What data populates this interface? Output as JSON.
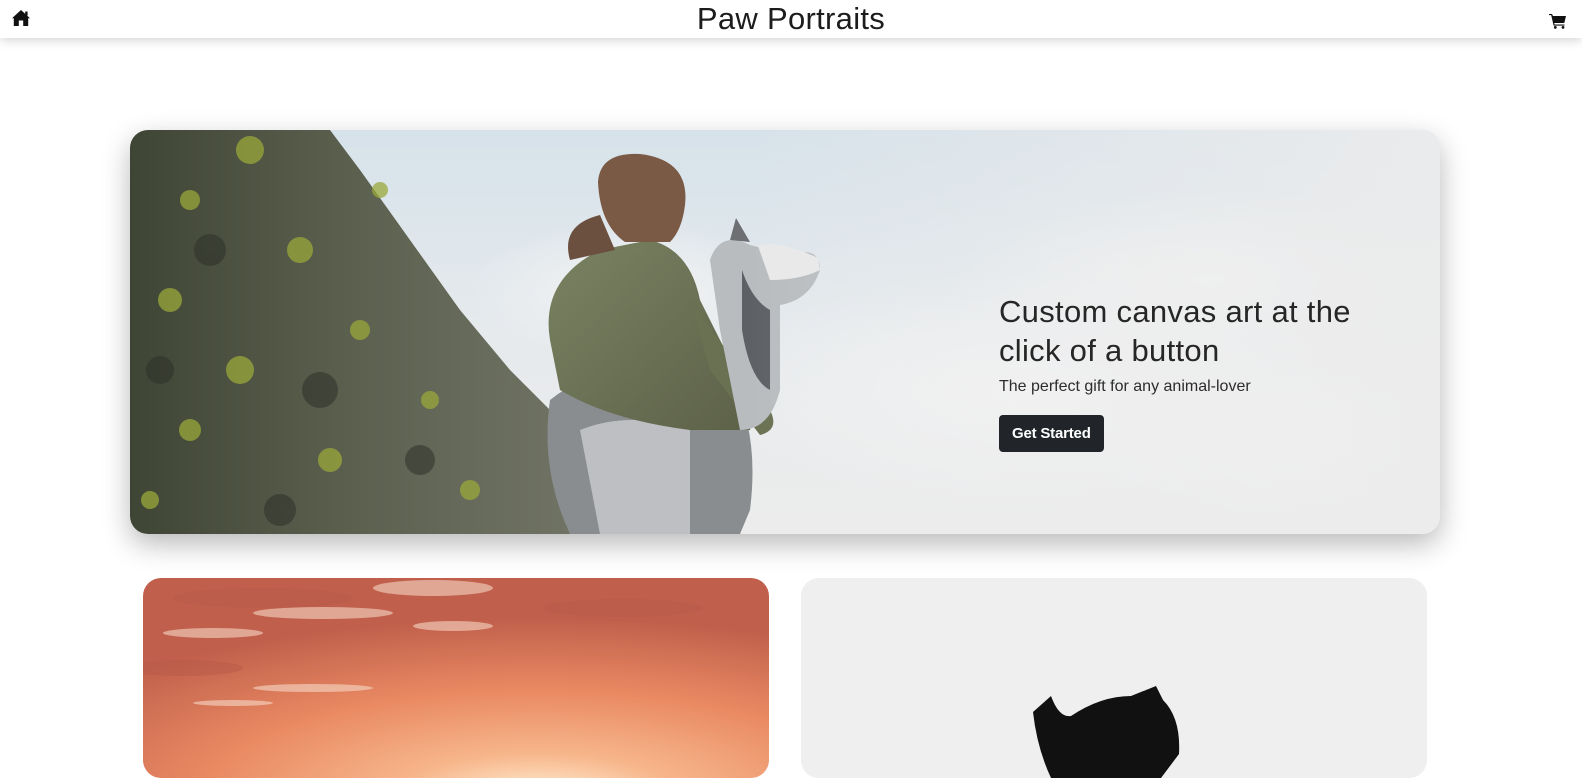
{
  "nav": {
    "home_icon": "home-icon",
    "title": "Paw Portraits",
    "cart_icon": "shopping-cart-icon"
  },
  "hero": {
    "heading": "Custom canvas art at the click of a button",
    "subtitle": "The perfect gift for any animal-lover",
    "cta_label": "Get Started",
    "image": "woman-with-husky-on-mountain-photo"
  },
  "cards": [
    {
      "image": "sunset-sky-photo"
    },
    {
      "image": "black-cat-silhouette-photo"
    }
  ],
  "colors": {
    "button_bg": "#212529",
    "button_text": "#ffffff",
    "title_text": "#1c1c1c"
  }
}
